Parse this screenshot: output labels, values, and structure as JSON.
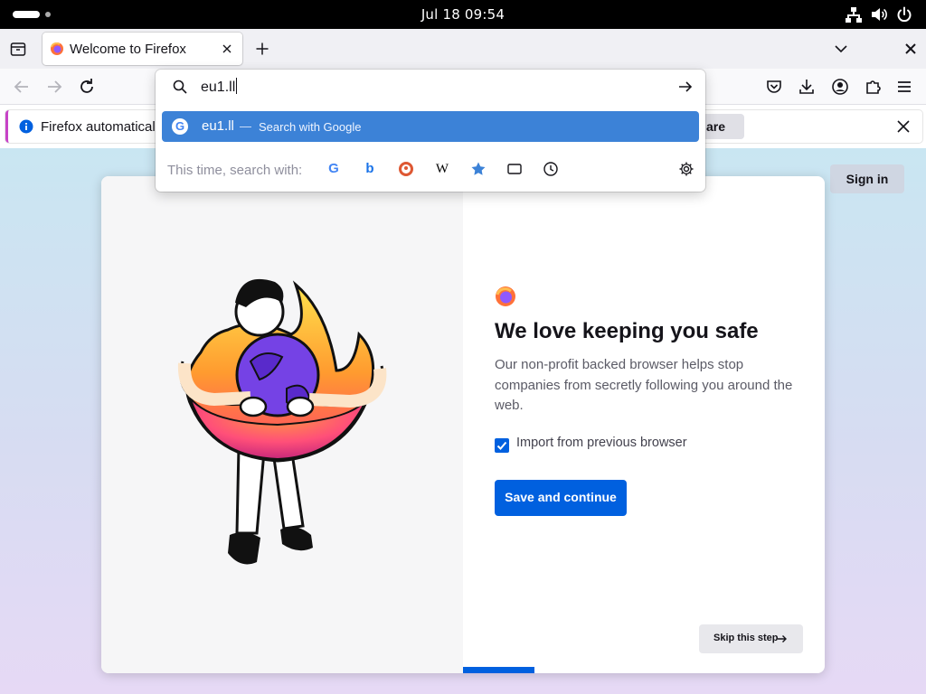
{
  "system": {
    "clock": "Jul 18  09:54"
  },
  "tab": {
    "title": "Welcome to Firefox"
  },
  "urlbar": {
    "value": "eu1.ll",
    "suggestion": {
      "text": "eu1.ll",
      "separator": "—",
      "action": "Search with Google"
    },
    "search_with_label": "This time, search with:",
    "engines": [
      "google-icon",
      "bing-icon",
      "duckduckgo-icon",
      "wikipedia-icon",
      "bookmarks-icon",
      "tabs-icon",
      "history-icon"
    ],
    "engine_letters": {
      "google": "G",
      "wikipedia": "W",
      "bing": "b"
    }
  },
  "notification": {
    "text": "Firefox automatical",
    "button_label": "are"
  },
  "page": {
    "signin_label": "Sign in",
    "heading": "We love keeping you safe",
    "description": "Our non-profit backed browser helps stop companies from secretly following you around the web.",
    "checkbox_label": "Import from previous browser",
    "checkbox_checked": true,
    "primary_button": "Save and continue",
    "skip_button": "Skip this step"
  },
  "colors": {
    "accent": "#0060df",
    "suggestion_highlight": "#3c82d7",
    "topbar": "#000000"
  }
}
